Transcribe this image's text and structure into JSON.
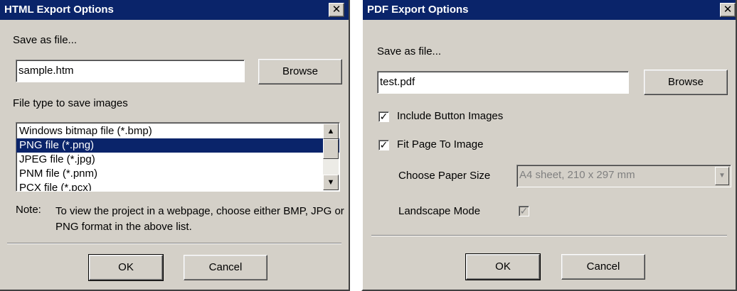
{
  "html_dialog": {
    "title": "HTML Export Options",
    "close_glyph": "✕",
    "save_as_label": "Save as file...",
    "filename_value": "sample.htm",
    "browse_label": "Browse",
    "file_type_label": "File type to save images",
    "file_types": [
      "Windows bitmap file (*.bmp)",
      "PNG file (*.png)",
      "JPEG file (*.jpg)",
      "PNM file (*.pnm)",
      "PCX file (*.pcx)"
    ],
    "selected_file_type": "PNG file (*.png)",
    "note_label": "Note:",
    "note_text": "To view the project in a webpage, choose either BMP, JPG or PNG format in the above list.",
    "ok_label": "OK",
    "cancel_label": "Cancel"
  },
  "pdf_dialog": {
    "title": "PDF Export Options",
    "close_glyph": "✕",
    "save_as_label": "Save as file...",
    "filename_value": "test.pdf",
    "browse_label": "Browse",
    "include_button_images_label": "Include Button Images",
    "include_button_images_checked": true,
    "fit_page_label": "Fit Page To Image",
    "fit_page_checked": true,
    "paper_size_label": "Choose Paper Size",
    "paper_size_value": "A4 sheet, 210 x 297 mm",
    "landscape_label": "Landscape Mode",
    "landscape_checked": true,
    "ok_label": "OK",
    "cancel_label": "Cancel"
  },
  "icons": {
    "check": "✓",
    "scroll_up": "▲",
    "scroll_down": "▼",
    "dropdown": "▼"
  },
  "colors": {
    "titlebar": "#0a246a",
    "dialog_face": "#d4d0c8",
    "selection": "#0a246a",
    "disabled_text": "#808080"
  }
}
